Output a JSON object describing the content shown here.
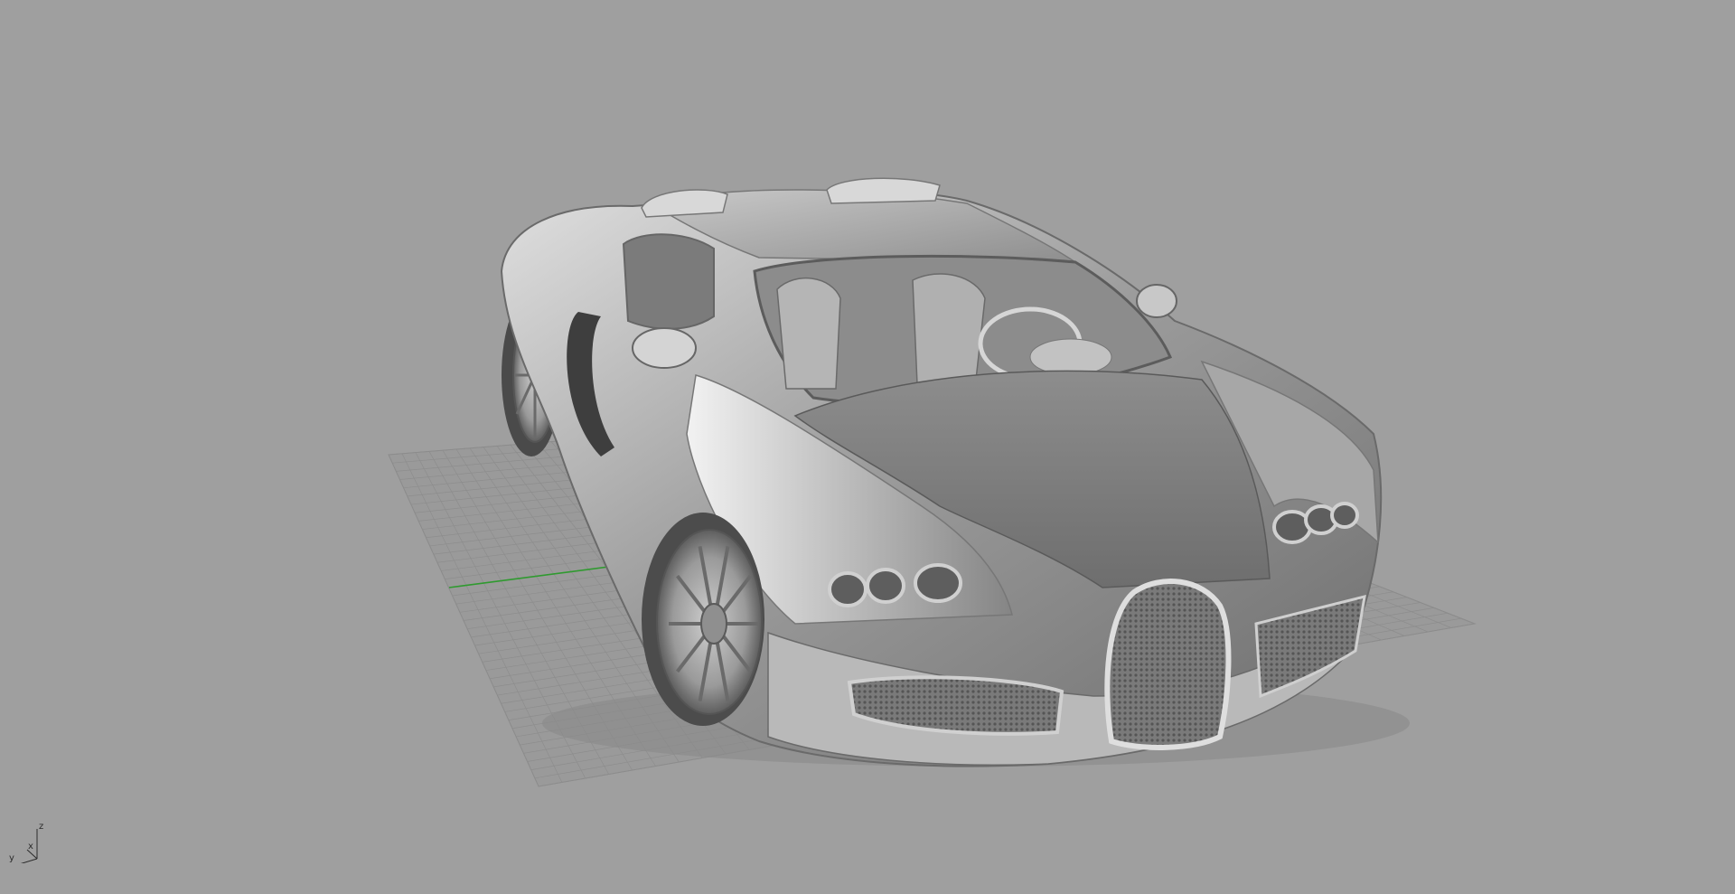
{
  "viewport": {
    "background_color": "#9f9f9f",
    "grid_color": "#8a8a8a",
    "x_axis_color": "#b04040",
    "y_axis_color": "#2f9a2f",
    "shading": "gray-shaded",
    "model": "sports-car"
  },
  "axis_widget": {
    "z_label": "z",
    "x_label": "x",
    "y_label": "y"
  }
}
